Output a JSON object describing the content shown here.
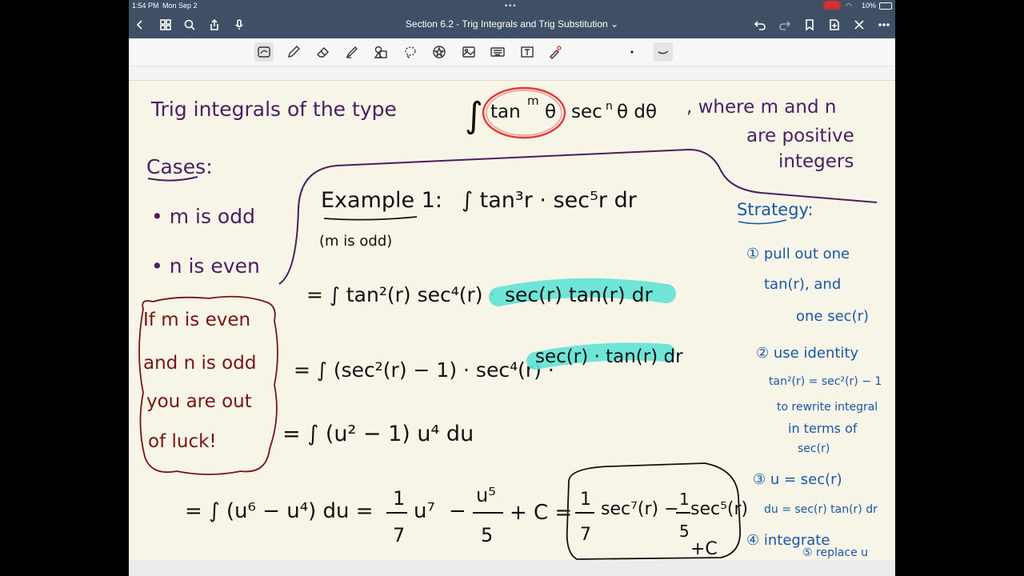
{
  "status_bar": {
    "time": "1:54 PM",
    "date": "Mon Sep 2",
    "battery": "10%"
  },
  "title_bar": {
    "title": "Section 6.2 - Trig Integrals and Trig Substitution",
    "title_chevron": "⌄"
  },
  "toolbar": {
    "tools": [
      "lasso-select",
      "pen",
      "eraser",
      "highlighter",
      "shapes",
      "lasso",
      "sticker",
      "image",
      "keyboard",
      "text",
      "laser-pointer"
    ]
  },
  "note": {
    "heading": {
      "prefix": "Trig integrals of the type",
      "integral": "∫",
      "tan": "tan",
      "m": "m",
      "theta1": "θ",
      "sec": "sec",
      "n": "n",
      "theta2": "θ dθ",
      "suffix": ", where m and n",
      "line2": "are positive",
      "line3": "integers"
    },
    "cases": {
      "label": "Cases:",
      "case1": "• m is odd",
      "case2": "• n is even"
    },
    "warning": {
      "line1": "If m is even",
      "line2": "and n is odd",
      "line3": "you are out",
      "line4": "of luck!"
    },
    "example": {
      "label": "Example 1:",
      "note": "(m is odd)",
      "problem": "∫ tan³r · sec⁵r dr",
      "step1_main": "= ∫ tan²(r) sec⁴(r) ·",
      "step1_hl": "sec(r) tan(r) dr",
      "step2_main": "= ∫ (sec²(r) − 1) · sec⁴(r) ·",
      "step2_hl": "sec(r) · tan(r) dr",
      "step3": "= ∫ (u² − 1) u⁴ du",
      "step4": "= ∫ (u⁶ − u⁴) du = ",
      "frac1_num": "1",
      "frac1_den": "7",
      "u7": "u⁷",
      "minus": "−",
      "frac2_num": "u⁵",
      "frac2_den": "5",
      "plusC": "+ C =",
      "ans_frac1_num": "1",
      "ans_frac1_den": "7",
      "ans_sec7": "sec⁷(r) −",
      "ans_frac2_num": "1",
      "ans_frac2_den": "5",
      "ans_sec5": "sec⁵(r)",
      "ans_c": "+C"
    },
    "strategy": {
      "label": "Strategy:",
      "s1a": "① pull out one",
      "s1b": "tan(r), and",
      "s1c": "one sec(r)",
      "s2a": "② use identity",
      "s2b": "tan²(r) = sec²(r) − 1",
      "s2c": "to rewrite integral",
      "s2d": "in terms of",
      "s2e": "sec(r)",
      "s3a": "③ u = sec(r)",
      "s3b": "du = sec(r) tan(r) dr",
      "s4a": "④ integrate",
      "s4b": "⑤ replace u"
    }
  },
  "colors": {
    "chrome": "#3f4f66",
    "paper": "#f6f5e8",
    "ink_purple": "#4b1d63",
    "ink_maroon": "#7a1412",
    "ink_blue": "#1b57a8",
    "highlight": "#5fe3d4",
    "circle_red": "#e53935"
  }
}
